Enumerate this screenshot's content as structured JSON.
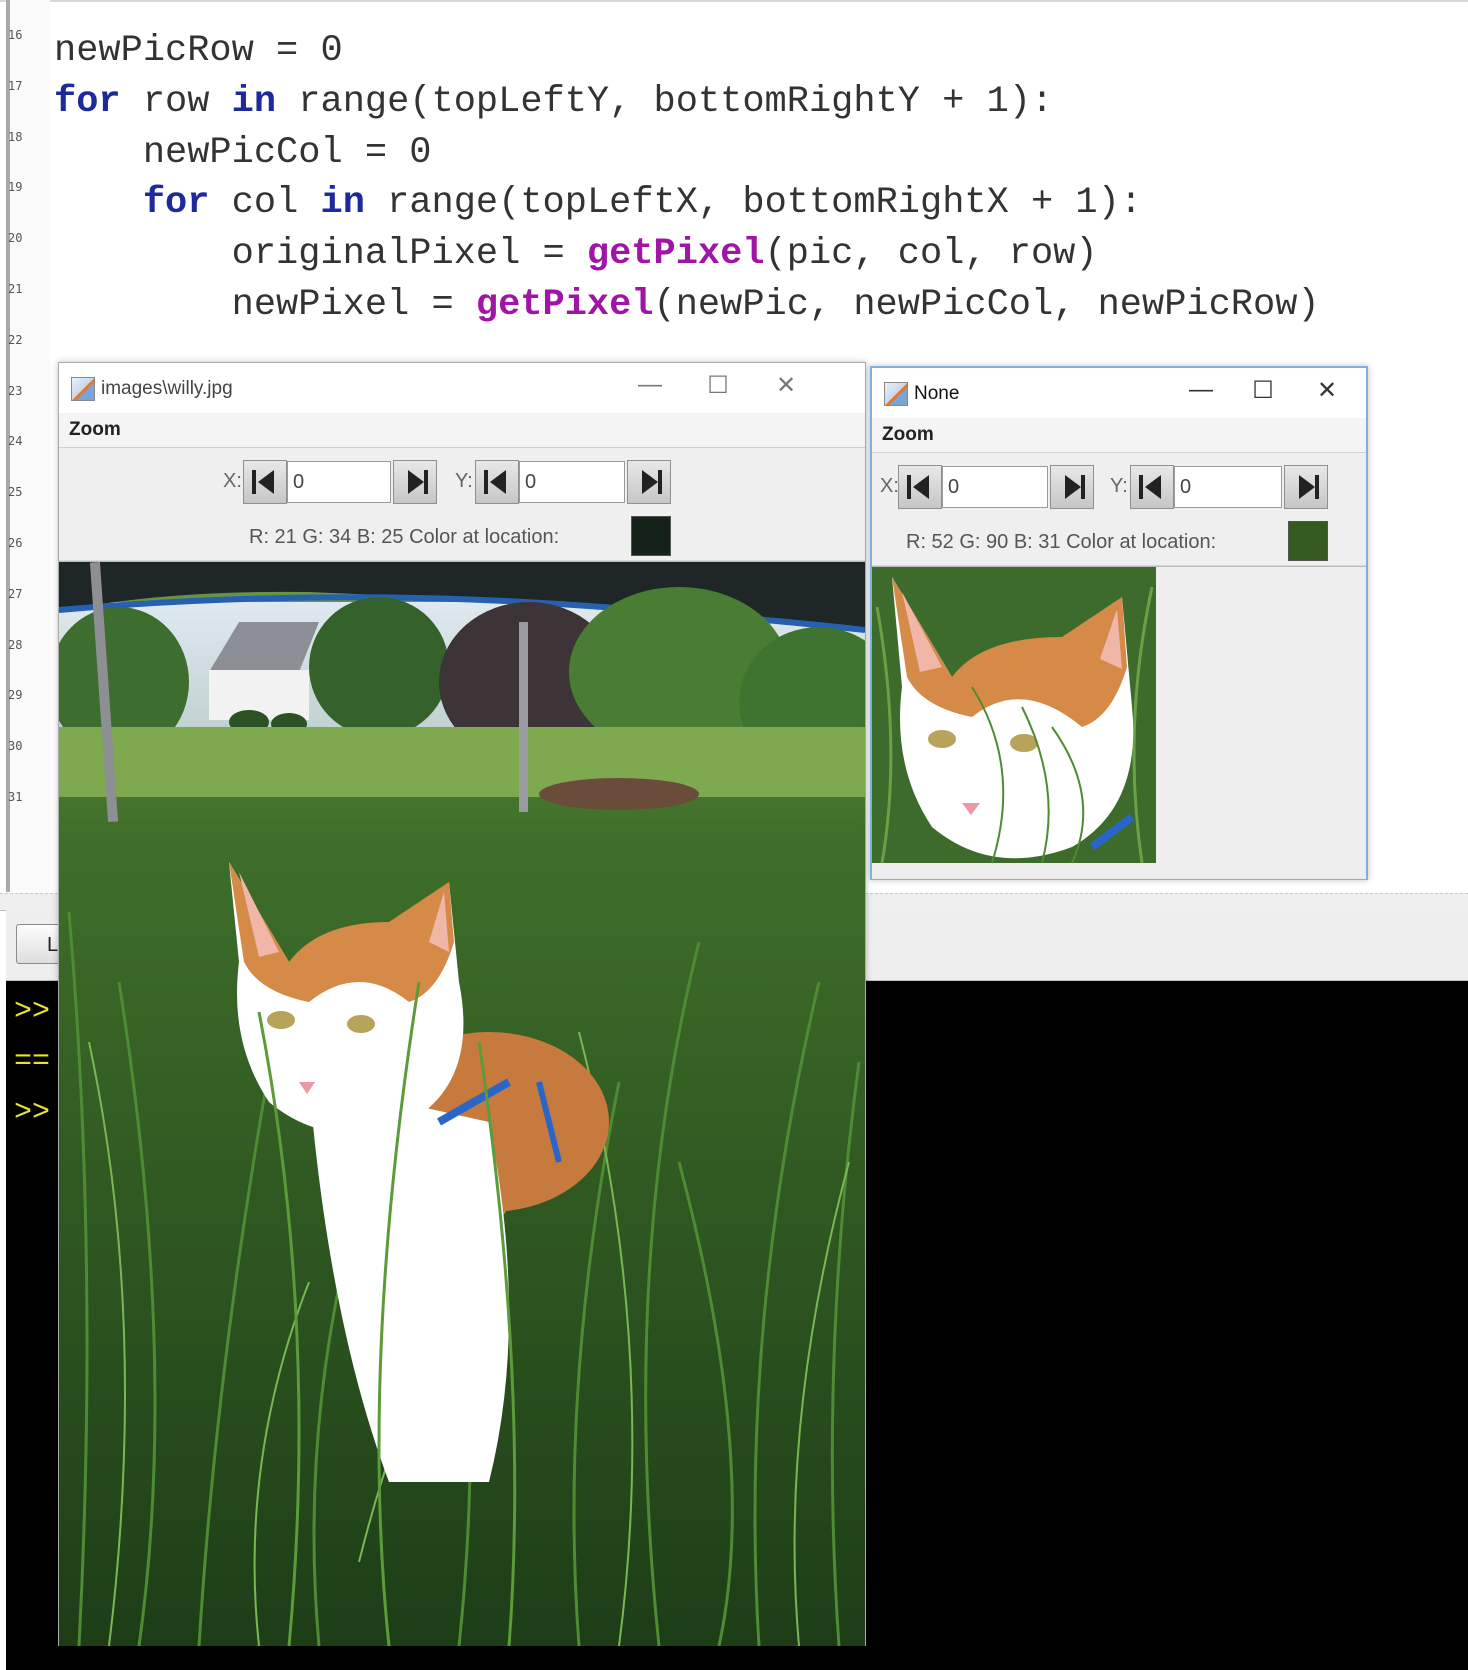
{
  "editor": {
    "line_numbers": [
      "16",
      "17",
      "18",
      "19",
      "20",
      "21",
      "22",
      "23",
      "24",
      "25",
      "26",
      "27",
      "28",
      "29",
      "30",
      "31"
    ],
    "lines": [
      {
        "segments": [
          {
            "t": "newPicRow = 0",
            "c": ""
          }
        ]
      },
      {
        "segments": [
          {
            "t": "for",
            "c": "kw"
          },
          {
            "t": " row ",
            "c": ""
          },
          {
            "t": "in",
            "c": "kw"
          },
          {
            "t": " range(topLeftY, bottomRightY + 1):",
            "c": ""
          }
        ]
      },
      {
        "segments": [
          {
            "t": "    newPicCol = 0",
            "c": ""
          }
        ]
      },
      {
        "segments": [
          {
            "t": "    ",
            "c": ""
          },
          {
            "t": "for",
            "c": "kw"
          },
          {
            "t": " col ",
            "c": ""
          },
          {
            "t": "in",
            "c": "kw"
          },
          {
            "t": " range(topLeftX, bottomRightX + 1):",
            "c": ""
          }
        ]
      },
      {
        "segments": [
          {
            "t": "        originalPixel = ",
            "c": ""
          },
          {
            "t": "getPixel",
            "c": "fn"
          },
          {
            "t": "(pic, col, row)",
            "c": ""
          }
        ]
      },
      {
        "segments": [
          {
            "t": "        newPixel = ",
            "c": ""
          },
          {
            "t": "getPixel",
            "c": "fn"
          },
          {
            "t": "(newPic, newPicCol, newPicRow)",
            "c": ""
          }
        ]
      }
    ]
  },
  "toolbar": {
    "load_label": "Lo"
  },
  "console": {
    "lines": [
      ">>",
      "==",
      ">>"
    ]
  },
  "window_original": {
    "title": "images\\willy.jpg",
    "menu_zoom": "Zoom",
    "x_label": "X:",
    "x_value": "0",
    "y_label": "Y:",
    "y_value": "0",
    "color_text": "R: 21 G: 34 B: 25 Color at location:",
    "swatch_color": "#152219",
    "minimize": "—",
    "maximize": "☐",
    "close": "✕"
  },
  "window_new": {
    "title": "None",
    "menu_zoom": "Zoom",
    "x_label": "X:",
    "x_value": "0",
    "y_label": "Y:",
    "y_value": "0",
    "color_text": "R: 52 G: 90 B: 31 Color at location:",
    "swatch_color": "#345a1f",
    "minimize": "—",
    "maximize": "☐",
    "close": "✕"
  },
  "colors": {
    "keyword": "#1e2a9c",
    "function": "#a015a6",
    "console_text": "#e8e230",
    "console_bg": "#000000"
  }
}
